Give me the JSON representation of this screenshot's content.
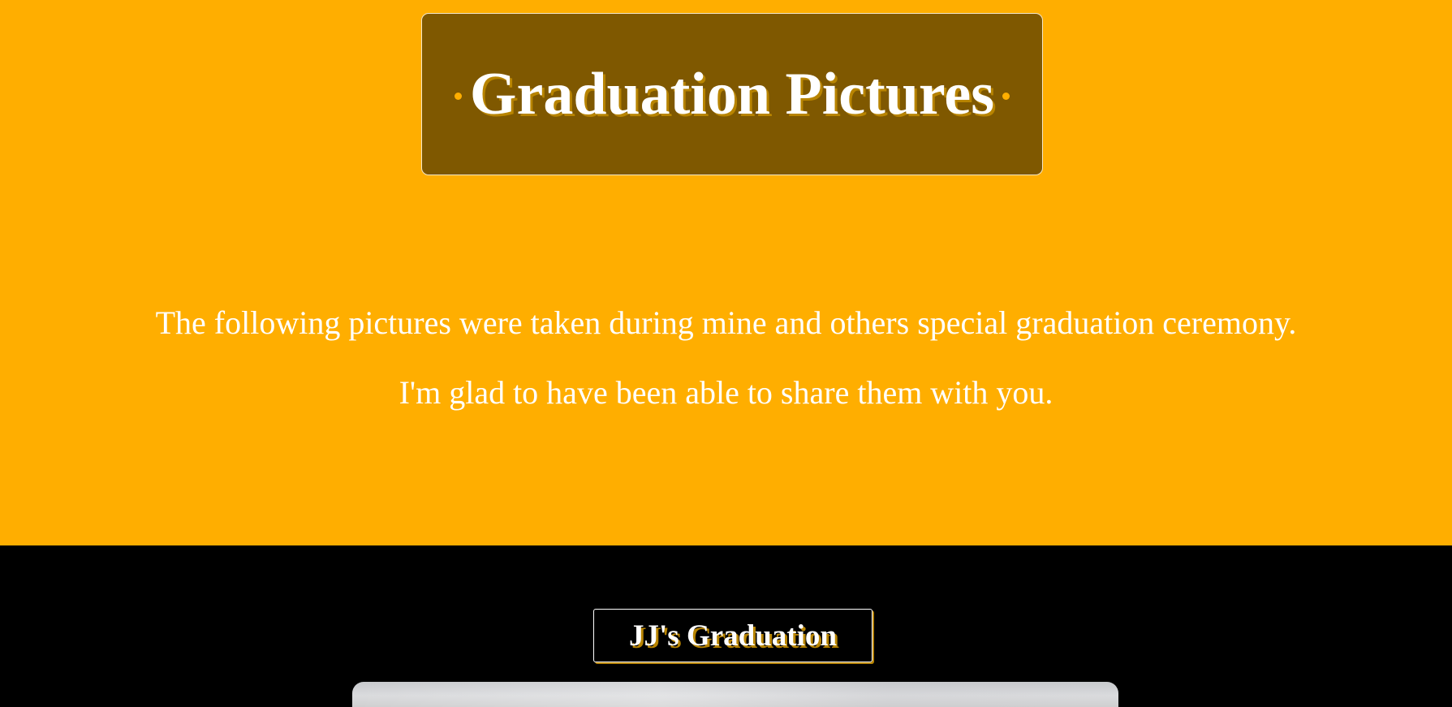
{
  "header": {
    "title": "Graduation Pictures"
  },
  "intro": {
    "line1": "The following pictures were taken during mine and others special graduation ceremony.",
    "line2": "I'm glad to have been able to share them with you."
  },
  "gallery": {
    "section_title": "JJ's Graduation",
    "photo_alt": "Graduation photo"
  },
  "colors": {
    "accent": "#FFAE00",
    "title_box": "#7F5800",
    "text": "#FFFFFF",
    "gallery_background": "#000000"
  }
}
